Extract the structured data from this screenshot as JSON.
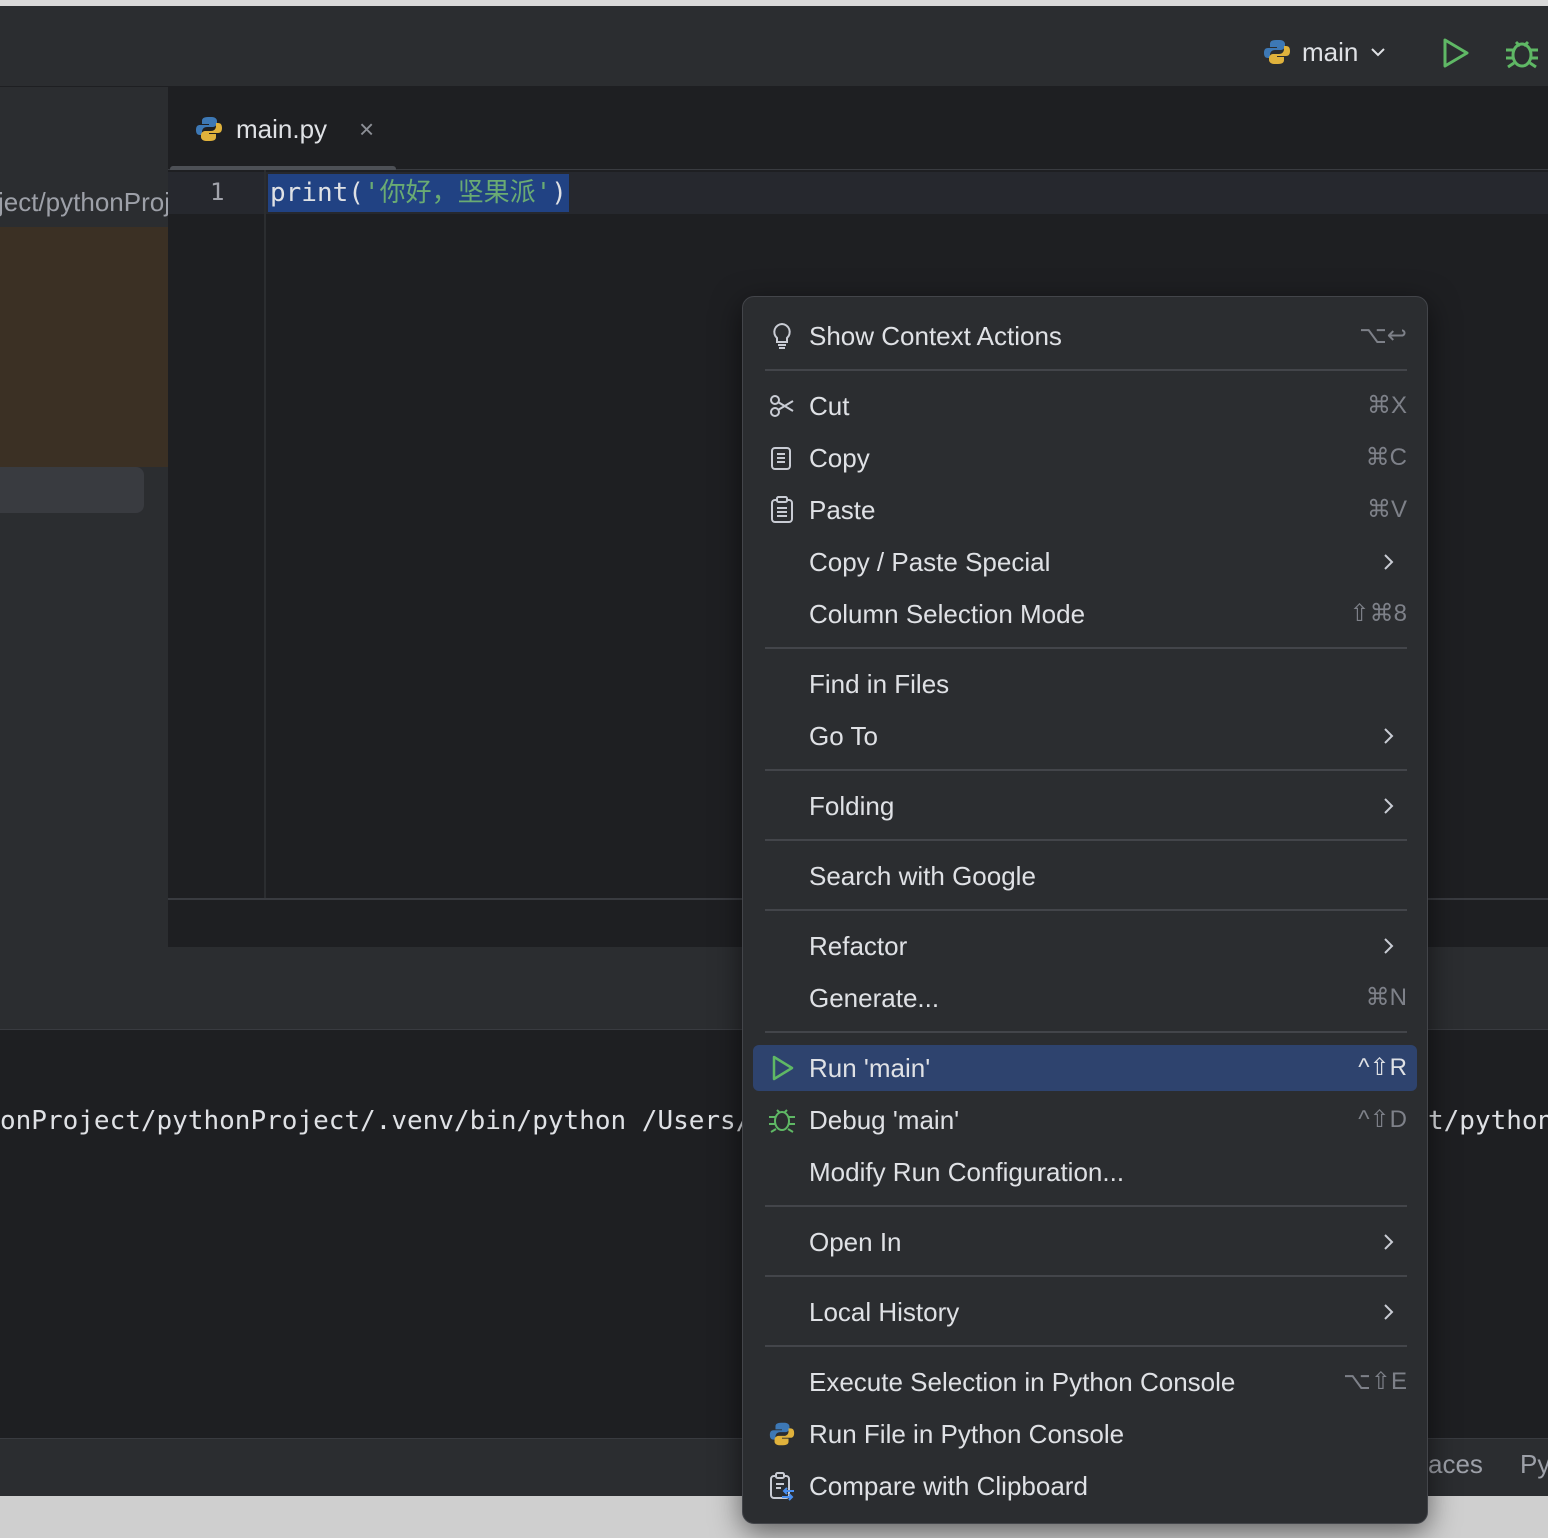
{
  "titlebar": {
    "run_config": "main"
  },
  "sidebar": {
    "path": "ject/pythonProject"
  },
  "editor": {
    "tab_label": "main.py",
    "tab_close": "×",
    "line_number": "1",
    "code": {
      "fn": "print(",
      "str": "'你好，坚果派'",
      "close": ")"
    }
  },
  "console": {
    "line": "onProject/pythonProject/.venv/bin/python /Users/",
    "right": "t/python"
  },
  "statusbar": {
    "tab1": "aces",
    "tab2": "Py"
  },
  "context_menu": {
    "items": [
      {
        "label": "Show Context Actions",
        "shortcut": "⌥↩",
        "icon": "lightbulb-icon"
      },
      {
        "label": "Cut",
        "shortcut": "⌘X",
        "icon": "scissors-icon"
      },
      {
        "label": "Copy",
        "shortcut": "⌘C",
        "icon": "copy-icon"
      },
      {
        "label": "Paste",
        "shortcut": "⌘V",
        "icon": "paste-icon"
      },
      {
        "label": "Copy / Paste Special",
        "submenu": true
      },
      {
        "label": "Column Selection Mode",
        "shortcut": "⇧⌘8"
      },
      {
        "label": "Find in Files"
      },
      {
        "label": "Go To",
        "submenu": true
      },
      {
        "label": "Folding",
        "submenu": true
      },
      {
        "label": "Search with Google"
      },
      {
        "label": "Refactor",
        "submenu": true
      },
      {
        "label": "Generate...",
        "shortcut": "⌘N"
      },
      {
        "label": "Run 'main'",
        "shortcut": "^⇧R",
        "icon": "run-icon",
        "selected": true
      },
      {
        "label": "Debug 'main'",
        "shortcut": "^⇧D",
        "icon": "debug-icon"
      },
      {
        "label": "Modify Run Configuration..."
      },
      {
        "label": "Open In",
        "submenu": true
      },
      {
        "label": "Local History",
        "submenu": true
      },
      {
        "label": "Execute Selection in Python Console",
        "shortcut": "⌥⇧E"
      },
      {
        "label": "Run File in Python Console",
        "icon": "python-icon"
      },
      {
        "label": "Compare with Clipboard",
        "icon": "compare-clipboard-icon"
      }
    ]
  },
  "colors": {
    "background": "#1e1f22",
    "panel": "#2b2d30",
    "selection": "#2e436e",
    "code_selection": "#214283",
    "string": "#6aab73",
    "run_green": "#5fb865"
  }
}
